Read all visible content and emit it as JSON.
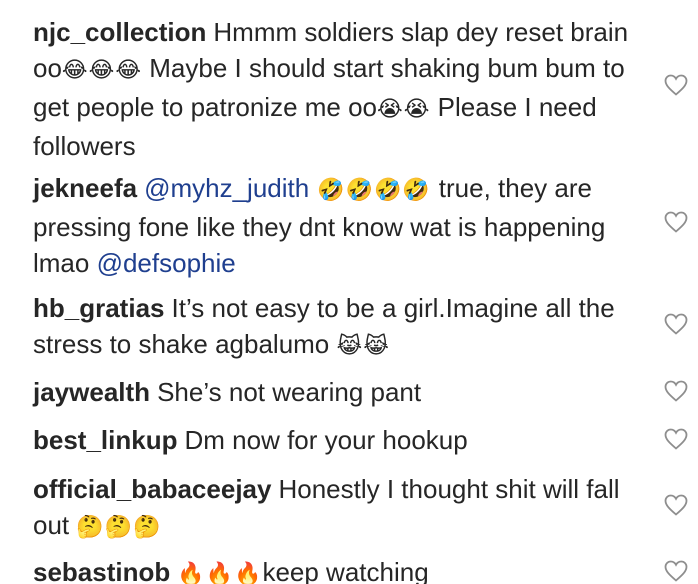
{
  "comments": [
    {
      "username": "njc_collection",
      "text_1": "Hmmm soldiers slap dey reset brain oo",
      "emoji_1": "😂😂😂",
      "text_2": " Maybe I should start shaking bum bum to get people to patronize me oo",
      "emoji_2": "😭😭",
      "text_3": " Please I need followers",
      "like_icon": "heart-outline-icon"
    },
    {
      "username": "jekneefa",
      "mention_1": "@myhz_judith",
      "emoji_1": " 🤣🤣🤣🤣 ",
      "text_1": "true, they are pressing fone like they dnt know wat is happening lmao ",
      "mention_2": "@defsophie",
      "like_icon": "heart-outline-icon"
    },
    {
      "username": "hb_gratias",
      "text_1": "It’s not easy to be a girl.Imagine all the stress to shake agbalumo ",
      "emoji_1": "😹😹",
      "like_icon": "heart-outline-icon"
    },
    {
      "username": "jaywealth",
      "text_1": "She’s not wearing pant",
      "like_icon": "heart-outline-icon"
    },
    {
      "username": "best_linkup",
      "text_1": "Dm now for your hookup",
      "like_icon": "heart-outline-icon"
    },
    {
      "username": "official_babaceejay",
      "text_1": "Honestly I thought shit will fall out ",
      "emoji_1": "🤔🤔🤔",
      "like_icon": "heart-outline-icon"
    },
    {
      "username": "sebastinob",
      "emoji_1": "🔥🔥🔥",
      "text_1": "keep watching",
      "like_icon": "heart-outline-icon"
    }
  ],
  "colors": {
    "text": "#262626",
    "mention": "#1f3f8f",
    "icon": "#8e8e8e",
    "background": "#ffffff"
  }
}
